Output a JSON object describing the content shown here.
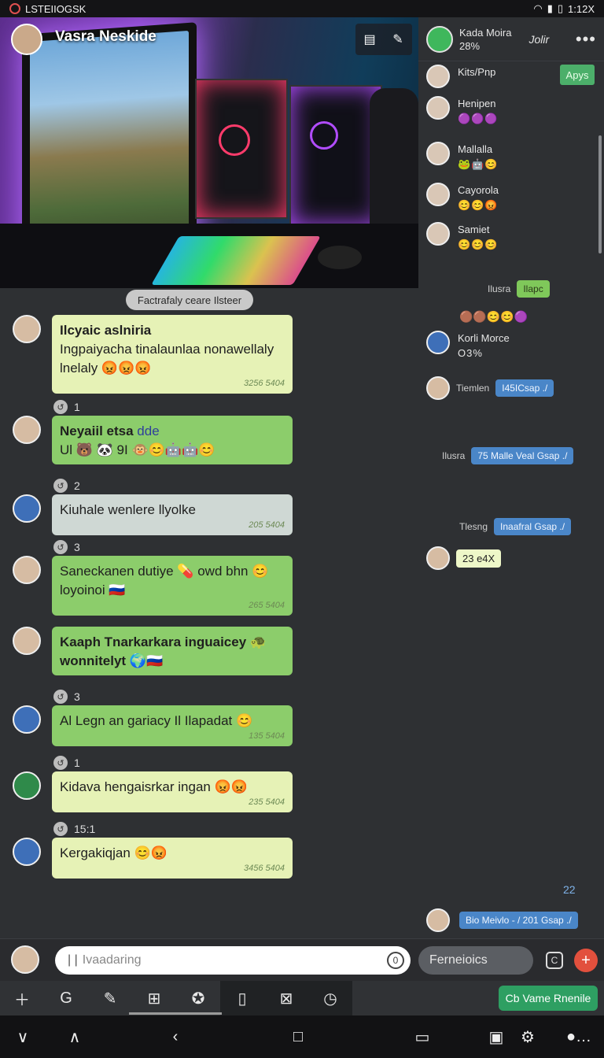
{
  "status_bar": {
    "app_label": "LSTEIIOGSK",
    "time": "1:12X"
  },
  "hero": {
    "title": "Vasra Neskide"
  },
  "right_panel": {
    "header": {
      "name": "Kada Moira",
      "sub": "28%",
      "mid": "Jolir",
      "more": "•••"
    },
    "apps_button": "Apys",
    "contacts": [
      {
        "name": "Kits/Pnp",
        "emoji": ""
      },
      {
        "name": "Henipen",
        "emoji": "🟣🟣🟣"
      },
      {
        "name": "Mallalla",
        "emoji": "🐸🤖😊"
      },
      {
        "name": "Cayorola",
        "emoji": "😊😊😡"
      },
      {
        "name": "Samiet",
        "emoji": "😊😊😊"
      }
    ],
    "messages": [
      {
        "label": "Ilusra",
        "text": "Ilapc"
      },
      {
        "label": "",
        "text": "🟤🟤😊😊🟣"
      },
      {
        "label": "Korli Morce",
        "text": "O3%"
      },
      {
        "label": "Tiemlen",
        "text": "I45ICsap ./"
      },
      {
        "label": "Ilusra",
        "text": "75 Malle Veal Gsap ./"
      },
      {
        "label": "Tlesng",
        "text": "Inaafral Gsap ./"
      },
      {
        "label": "",
        "text": "23 e4X"
      },
      {
        "label": "",
        "text": "22"
      },
      {
        "label": "",
        "text": "Bio Meivlo - / 201 Gsap ./"
      }
    ]
  },
  "chat": {
    "pill": "Factrafaly ceare Ilsteer",
    "messages": [
      {
        "title": "Ilcyaic aslniria",
        "body": "Ingpaiyacha tinalaunlaa nonawellaly lnelaly 😡😡😡",
        "time": "3256 5404"
      },
      {
        "counter": "1"
      },
      {
        "title": "Neyaiil etsa",
        "suffix": "dde",
        "body": "Ul 🐻 🐼 9I 🐵😊🤖🤖😊",
        "time": ""
      },
      {
        "counter": "2"
      },
      {
        "title": "",
        "body": "Kiuhale wenlere llyolke",
        "time": "205 5404"
      },
      {
        "counter": "3"
      },
      {
        "title": "",
        "body": "Saneckanen dutiye 💊 owd bhn 😊 loyoinoi 🇷🇺",
        "time": "265 5404"
      },
      {
        "title": "",
        "body": "Kaaph Tnarkarkara inguaicey 🐢 wonnitelyt 🌍🇷🇺",
        "time": ""
      },
      {
        "counter": "3"
      },
      {
        "title": "",
        "body": "Al Legn an gariacy Il Ilapadat 😊",
        "time": "135 5404"
      },
      {
        "counter": "1"
      },
      {
        "title": "",
        "body": "Kidava hengaisrkar ingan 😡😡",
        "time": "235 5404"
      },
      {
        "counter": "15:1"
      },
      {
        "title": "",
        "body": "Kergakiqjan 😊😡",
        "time": "3456 5404"
      }
    ]
  },
  "input_bar": {
    "placeholder": "Ivaadaring",
    "reply": "Ferneioics"
  },
  "toolbar": {
    "cta": "Cb Vame Rnenile"
  },
  "colors": {
    "accent_green": "#2e9f62",
    "bubble_lime": "#e6f2b6",
    "bubble_green": "#8ccd6b",
    "blue_bubble": "#4a86c8",
    "red_plus": "#e2503d"
  }
}
